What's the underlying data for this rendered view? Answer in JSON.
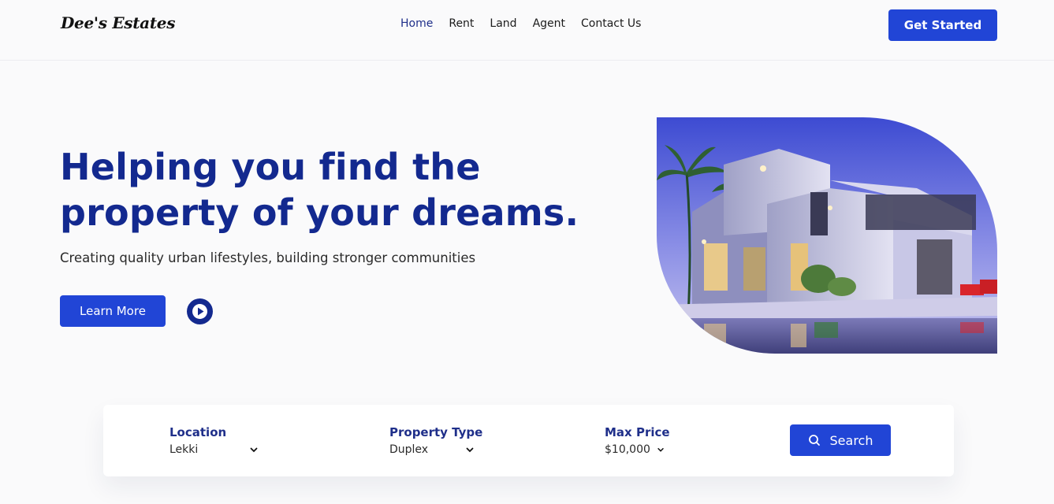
{
  "brand": {
    "name": "Dee's Estates"
  },
  "nav": {
    "links": [
      {
        "label": "Home",
        "active": true
      },
      {
        "label": "Rent"
      },
      {
        "label": "Land"
      },
      {
        "label": "Agent"
      },
      {
        "label": "Contact Us"
      }
    ],
    "cta_label": "Get Started"
  },
  "hero": {
    "title_line1": "Helping you find the",
    "title_line2": "property of your dreams.",
    "subtitle": "Creating quality urban lifestyles, building stronger communities",
    "learn_more_label": "Learn More",
    "play_icon": "play-icon",
    "image_icon": "modern-house-photo"
  },
  "search": {
    "location": {
      "label": "Location",
      "value": "Lekki"
    },
    "property_type": {
      "label": "Property Type",
      "value": "Duplex"
    },
    "max_price": {
      "label": "Max Price",
      "value": "$10,000"
    },
    "button_label": "Search",
    "button_icon": "search-icon"
  },
  "colors": {
    "accent": "#2145d6",
    "heading": "#13298f",
    "label": "#1f2f8a",
    "background": "#fafafb"
  }
}
